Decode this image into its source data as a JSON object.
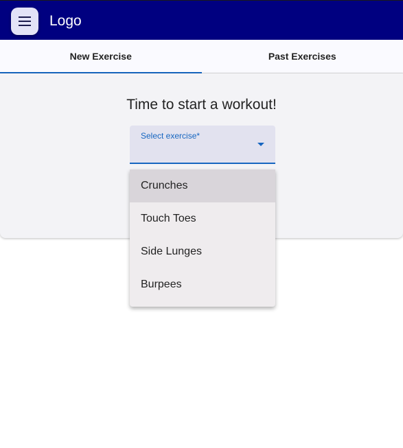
{
  "app_bar": {
    "logo": "Logo",
    "menu_icon": "menu-icon"
  },
  "tabs": [
    {
      "label": "New Exercise",
      "active": true
    },
    {
      "label": "Past Exercises",
      "active": false
    }
  ],
  "card": {
    "title": "Time to start a workout!"
  },
  "select": {
    "label": "Select exercise*",
    "value": "",
    "options": [
      "Crunches",
      "Touch Toes",
      "Side Lunges",
      "Burpees"
    ],
    "highlighted_option": "Crunches"
  },
  "colors": {
    "toolbar": "#000080",
    "accent": "#1565c0"
  }
}
